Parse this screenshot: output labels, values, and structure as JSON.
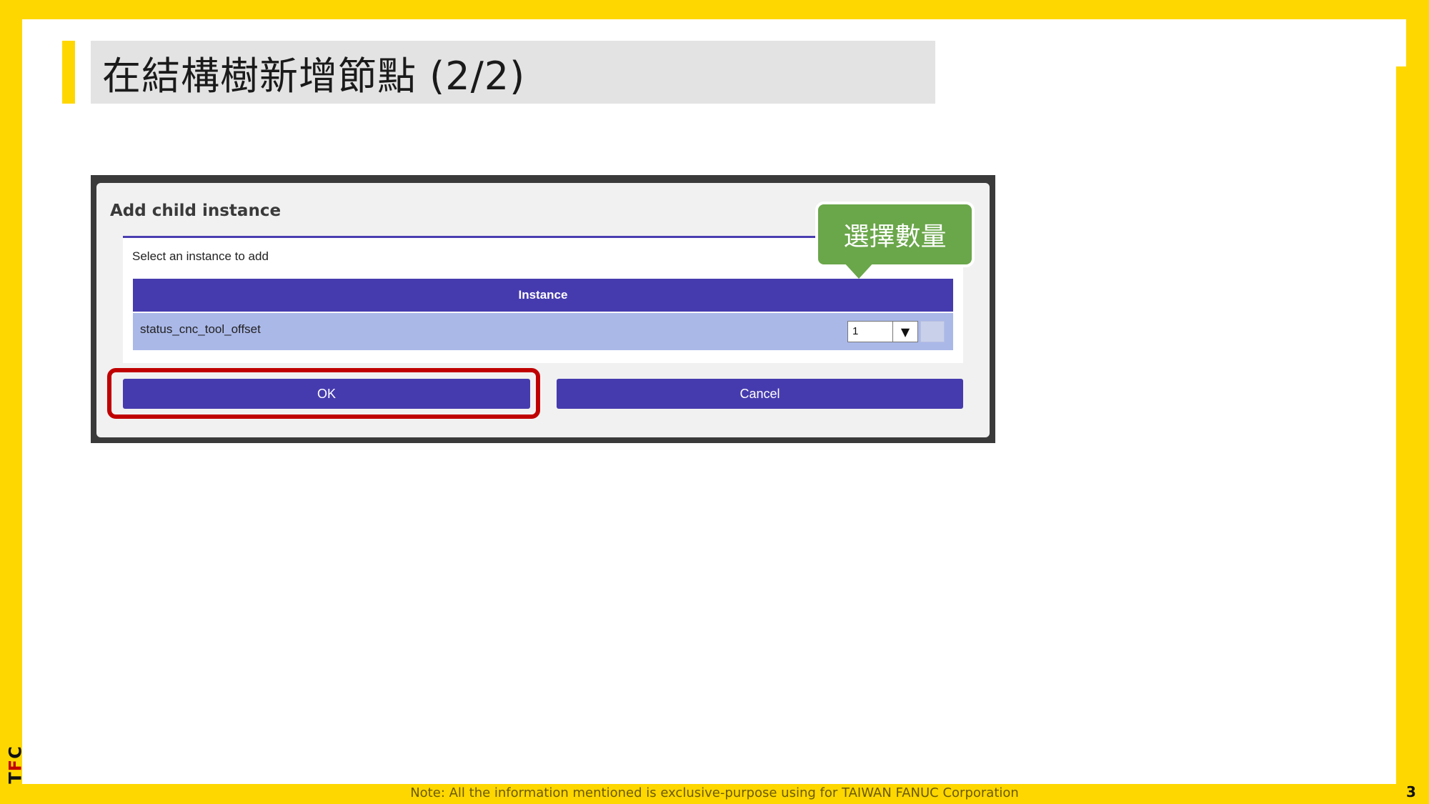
{
  "slide": {
    "title": "在結構樹新增節點 (2/2)",
    "footer_note": "Note: All the information mentioned is exclusive-purpose using for TAIWAN FANUC Corporation",
    "page_number": "3",
    "logo": {
      "t": "T",
      "f": "F",
      "c": "C"
    }
  },
  "dialog": {
    "title": "Add child instance",
    "caption": "Select an instance to add",
    "table": {
      "header": "Instance",
      "rows": [
        {
          "label": "status_cnc_tool_offset",
          "quantity": "1",
          "dropdown_icon": "▼"
        }
      ]
    },
    "ok_label": "OK",
    "cancel_label": "Cancel"
  },
  "callout": {
    "text": "選擇數量"
  },
  "colors": {
    "accent_yellow": "#FFD700",
    "dialog_purple": "#463BAE",
    "row_blue": "#AAB8E8",
    "highlight_red": "#C00000",
    "callout_green": "#6AA64A"
  }
}
